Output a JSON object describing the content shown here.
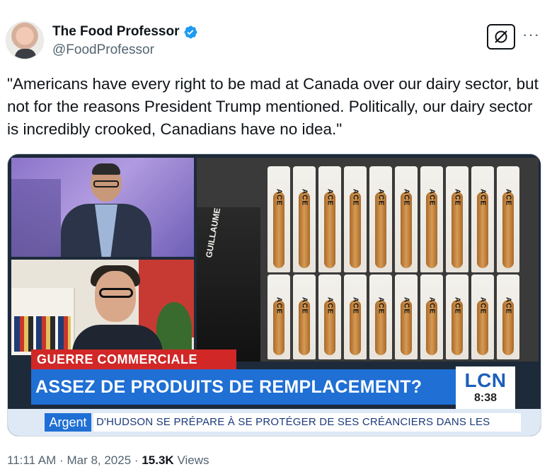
{
  "author": {
    "display_name": "The Food Professor",
    "handle": "@FoodProfessor",
    "verified": true,
    "verified_color": "#1d9bf0"
  },
  "actions": {
    "grok_icon": "grok-icon",
    "more_icon": "more-horizontal-icon",
    "more_label": "···"
  },
  "tweet": {
    "text": "\"Americans have every right to be mad at Canada over our dairy sector, but not for the reasons President Trump mentioned. Politically, our dairy sector is incredibly crooked, Canadians have no idea.\""
  },
  "media": {
    "bread_label": "ACE",
    "bag_text": "GUILLAUME",
    "lower_third_category": "GUERRE COMMERCIALE",
    "lower_third_headline": "ASSEZ DE PRODUITS DE REMPLACEMENT?",
    "network_logo": "LCN",
    "clock": "8:38",
    "ticker_category": "Argent",
    "ticker_text": "D'HUDSON SE PRÉPARE À SE PROTÉGER DE SES CRÉANCIERS DANS LES",
    "colors": {
      "red_band": "#d12727",
      "blue_band": "#1f6fd4",
      "lcn_blue": "#1c5fb8"
    }
  },
  "meta": {
    "time": "11:11 AM",
    "separator": "·",
    "date": "Mar 8, 2025",
    "views_count": "15.3K",
    "views_label": "Views"
  }
}
